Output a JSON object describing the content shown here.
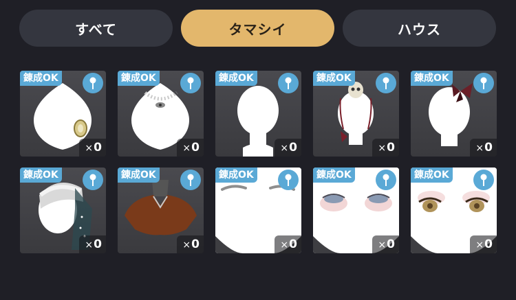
{
  "tabs": [
    {
      "label": "すべて",
      "active": false
    },
    {
      "label": "タマシイ",
      "active": true
    },
    {
      "label": "ハウス",
      "active": false
    }
  ],
  "items": [
    {
      "badge": "錬成OK",
      "icon": "pin-icon",
      "count_prefix": "×",
      "count": "0",
      "art": "brooch-on-bust"
    },
    {
      "badge": "錬成OK",
      "icon": "pin-icon",
      "count_prefix": "×",
      "count": "0",
      "art": "pearl-necklace-on-bust"
    },
    {
      "badge": "錬成OK",
      "icon": "pin-icon",
      "count_prefix": "×",
      "count": "0",
      "art": "plain-head"
    },
    {
      "badge": "錬成OK",
      "icon": "pin-icon",
      "count_prefix": "×",
      "count": "0",
      "art": "skull-hair-accessory"
    },
    {
      "badge": "錬成OK",
      "icon": "pin-icon",
      "count_prefix": "×",
      "count": "0",
      "art": "butterfly-hair-clip"
    },
    {
      "badge": "錬成OK",
      "icon": "pin-icon",
      "count_prefix": "×",
      "count": "0",
      "art": "bonnet-with-veil"
    },
    {
      "badge": "錬成OK",
      "icon": "pin-icon",
      "count_prefix": "×",
      "count": "0",
      "art": "brown-blouse"
    },
    {
      "badge": "錬成OK",
      "icon": "pin-icon",
      "count_prefix": "×",
      "count": "0",
      "art": "eyebrows"
    },
    {
      "badge": "錬成OK",
      "icon": "pin-icon",
      "count_prefix": "×",
      "count": "0",
      "art": "blue-eyes"
    },
    {
      "badge": "錬成OK",
      "icon": "pin-icon",
      "count_prefix": "×",
      "count": "0",
      "art": "brown-eyes"
    }
  ],
  "colors": {
    "background": "#1f1f26",
    "tab_inactive": "#34363f",
    "tab_active": "#e3b76c",
    "badge": "#5aa9d6"
  }
}
